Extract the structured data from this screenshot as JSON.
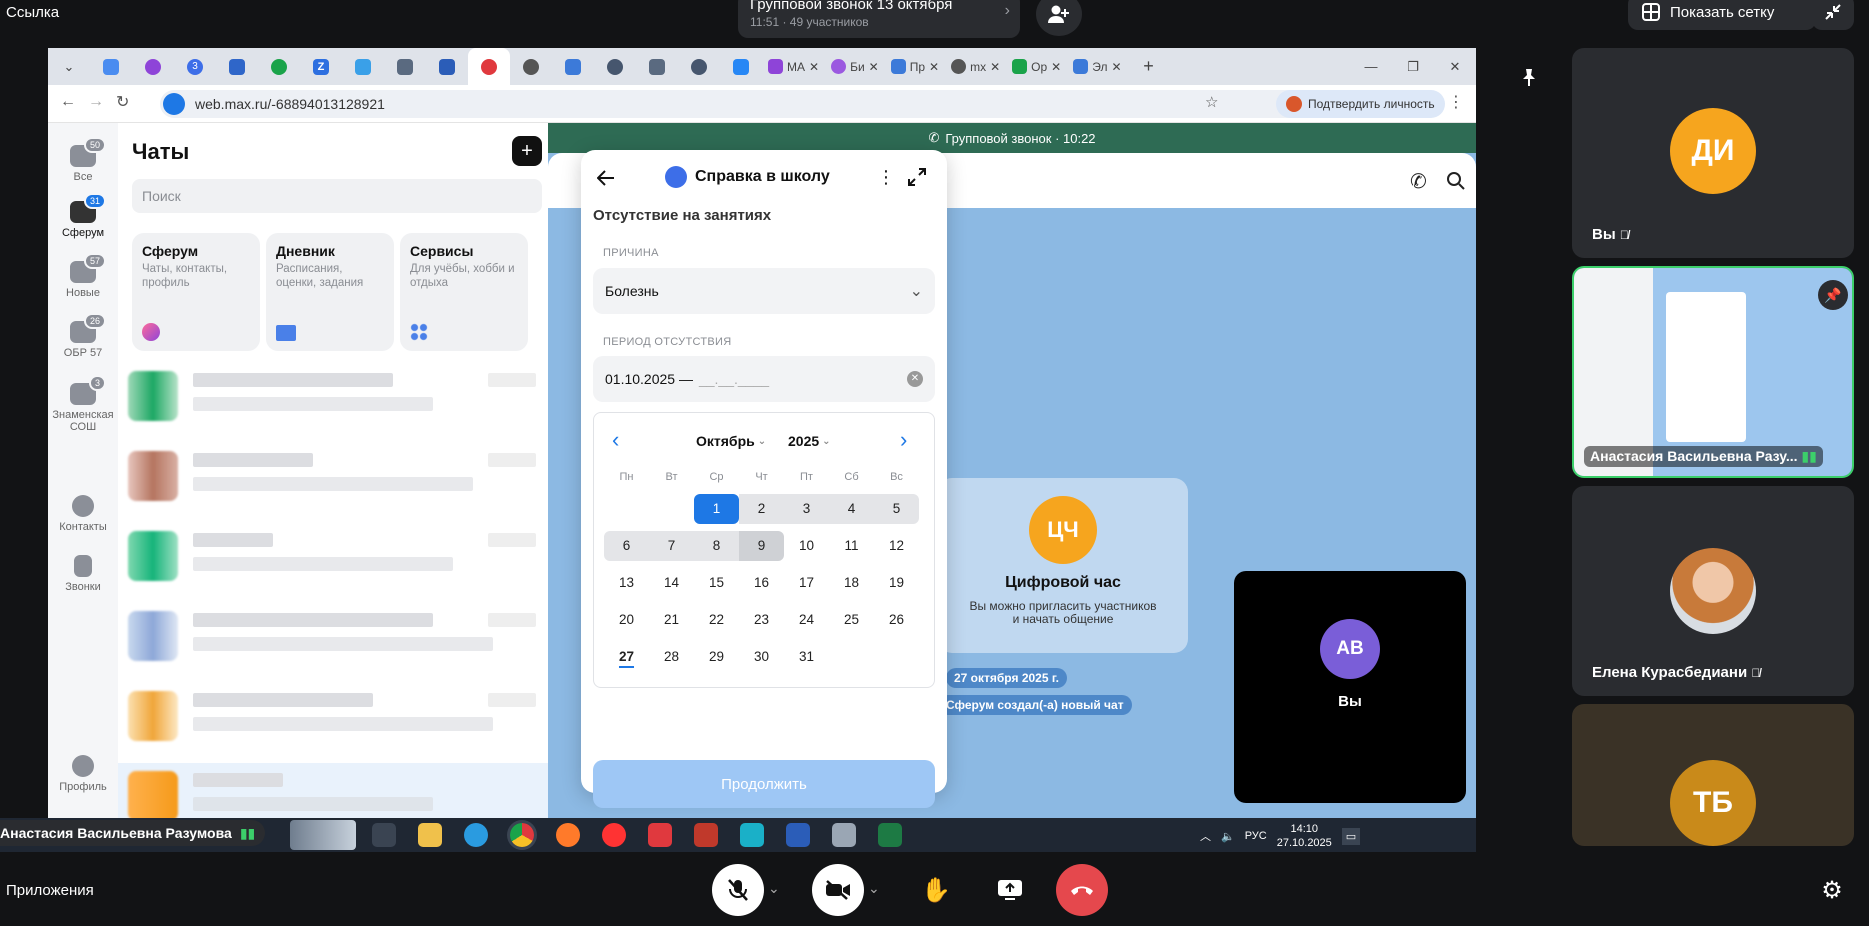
{
  "call_bar": {
    "link_label": "Ссылка",
    "call_title": "Групповой звонок 13 октября",
    "call_meta": "11:51 · 49 участников",
    "grid_button": "Показать сетку"
  },
  "browser": {
    "tabs_short": [
      "",
      "",
      "",
      "3",
      "",
      "",
      "Z",
      "",
      "",
      "",
      "",
      "",
      "",
      "",
      "",
      "",
      "",
      ""
    ],
    "tabs_labeled": [
      "MA",
      "Би",
      "Пр",
      "mx",
      "Ор",
      "Эл"
    ],
    "url": "web.max.ru/-68894013128921",
    "verify_button": "Подтвердить личность"
  },
  "nav": {
    "items": [
      {
        "label": "Все",
        "badge": "50"
      },
      {
        "label": "Сферум",
        "badge": "31"
      },
      {
        "label": "Новые",
        "badge": "57"
      },
      {
        "label": "ОБР 57",
        "badge": "26"
      },
      {
        "label": "Знаменская СОШ",
        "badge": "3"
      },
      {
        "label": "Контакты",
        "badge": ""
      },
      {
        "label": "Звонки",
        "badge": ""
      },
      {
        "label": "Профиль",
        "badge": ""
      }
    ]
  },
  "chats": {
    "title": "Чаты",
    "search_placeholder": "Поиск",
    "services": [
      {
        "title": "Сферум",
        "desc": "Чаты, контакты, профиль"
      },
      {
        "title": "Дневник",
        "desc": "Расписания, оценки, задания"
      },
      {
        "title": "Сервисы",
        "desc": "Для учёбы, хобби и отдыха"
      }
    ]
  },
  "call_area": {
    "banner": "Групповой звонок · 10:22",
    "group_initials": "ЦЧ",
    "group_name": "Цифровой час",
    "group_hint": "Вы можно пригласить участников и начать общение",
    "date_chip": "27 октября 2025 г.",
    "system_msg": "Сферум создал(-а) новый чат",
    "self_initials": "АВ",
    "self_label": "Вы"
  },
  "dialog": {
    "title": "Справка в школу",
    "section": "Отсутствие на занятиях",
    "reason_label": "ПРИЧИНА",
    "reason_value": "Болезнь",
    "period_label": "ПЕРИОД ОТСУТСТВИЯ",
    "period_value": "01.10.2025 —",
    "period_placeholder": "__.__.____",
    "month": "Октябрь",
    "year": "2025",
    "weekdays": [
      "Пн",
      "Вт",
      "Ср",
      "Чт",
      "Пт",
      "Сб",
      "Вс"
    ],
    "days": [
      "1",
      "2",
      "3",
      "4",
      "5",
      "6",
      "7",
      "8",
      "9",
      "10",
      "11",
      "12",
      "13",
      "14",
      "15",
      "16",
      "17",
      "18",
      "19",
      "20",
      "21",
      "22",
      "23",
      "24",
      "25",
      "26",
      "27",
      "28",
      "29",
      "30",
      "31"
    ],
    "continue_label": "Продолжить"
  },
  "share_overlay": {
    "presenter": "Анастасия Васильевна Разумова",
    "tray_lang": "РУС",
    "tray_time": "14:10",
    "tray_date": "27.10.2025"
  },
  "participants": [
    {
      "initials": "ДИ",
      "name": "Вы",
      "color": "#f6a51e"
    },
    {
      "initials": "",
      "name": "Анастасия Васильевна Разу...",
      "color": ""
    },
    {
      "initials": "",
      "name": "Елена Курасбедиани",
      "color": ""
    },
    {
      "initials": "ТБ",
      "name": "",
      "color": "#c98a1a"
    }
  ],
  "bottom_bar": {
    "apps_label": "Приложения"
  },
  "colors": {
    "accent": "#1e78e5",
    "end_call": "#e5484d",
    "call_green": "#2e6b54"
  }
}
